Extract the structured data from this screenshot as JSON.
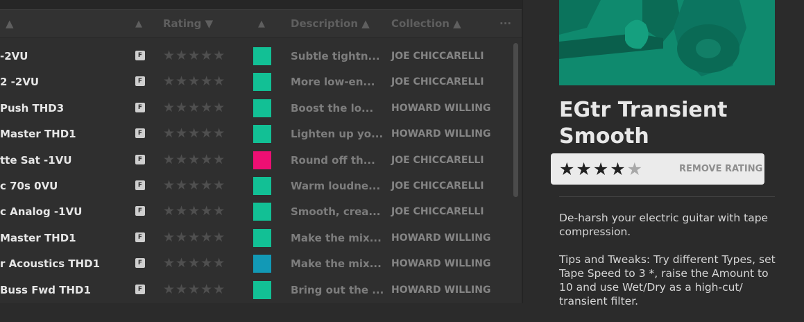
{
  "table": {
    "headers": {
      "name_sort": "▲",
      "f_sort": "▲",
      "rating": "Rating ▼",
      "color_sort": "▲",
      "description": "Description ▲",
      "collection": "Collection ▲",
      "more": "···"
    },
    "rows": [
      {
        "name": "-2VU",
        "badge": "F",
        "stars": "★★★★★",
        "color": "#12c095",
        "desc": "Subtle tightn...",
        "collection": "JOE CHICCARELLI"
      },
      {
        "name": "2 -2VU",
        "badge": "F",
        "stars": "★★★★★",
        "color": "#12c095",
        "desc": "More low-en...",
        "collection": "JOE CHICCARELLI"
      },
      {
        "name": "Push THD3",
        "badge": "F",
        "stars": "★★★★★",
        "color": "#12c095",
        "desc": "Boost the lo...",
        "collection": "HOWARD WILLING"
      },
      {
        "name": "Master THD1",
        "badge": "F",
        "stars": "★★★★★",
        "color": "#12c095",
        "desc": "Lighten up yo...",
        "collection": "HOWARD WILLING"
      },
      {
        "name": "tte Sat -1VU",
        "badge": "F",
        "stars": "★★★★★",
        "color": "#ee0f73",
        "desc": "Round off th...",
        "collection": "JOE CHICCARELLI"
      },
      {
        "name": "c 70s 0VU",
        "badge": "F",
        "stars": "★★★★★",
        "color": "#12c095",
        "desc": "Warm loudne...",
        "collection": "JOE CHICCARELLI"
      },
      {
        "name": "c Analog -1VU",
        "badge": "F",
        "stars": "★★★★★",
        "color": "#12c095",
        "desc": "Smooth, crea...",
        "collection": "JOE CHICCARELLI"
      },
      {
        "name": "Master THD1",
        "badge": "F",
        "stars": "★★★★★",
        "color": "#12c095",
        "desc": "Make the mix...",
        "collection": "HOWARD WILLING"
      },
      {
        "name": "r Acoustics THD1",
        "badge": "F",
        "stars": "★★★★★",
        "color": "#1299b6",
        "desc": "Make the mix...",
        "collection": "HOWARD WILLING"
      },
      {
        "name": "Buss Fwd THD1",
        "badge": "F",
        "stars": "★★★★★",
        "color": "#12c095",
        "desc": "Bring out the ...",
        "collection": "HOWARD WILLING"
      }
    ]
  },
  "detail": {
    "title": "EGtr Transient Smooth",
    "rating": {
      "filled": "★★★★",
      "empty": "★",
      "value": 4,
      "max": 5,
      "remove_label": "REMOVE RATING"
    },
    "description_1": "De-harsh your electric guitar with tape compression.",
    "description_2": "Tips and Tweaks: Try different Types, set Tape Speed to 3 *, raise the Amount to 10 and use Wet/Dry as a high-cut/ transient filter."
  },
  "colors": {
    "accent_green": "#12c095",
    "accent_pink": "#ee0f73",
    "accent_blue": "#1299b6",
    "art_green": "#0f8a6e"
  }
}
